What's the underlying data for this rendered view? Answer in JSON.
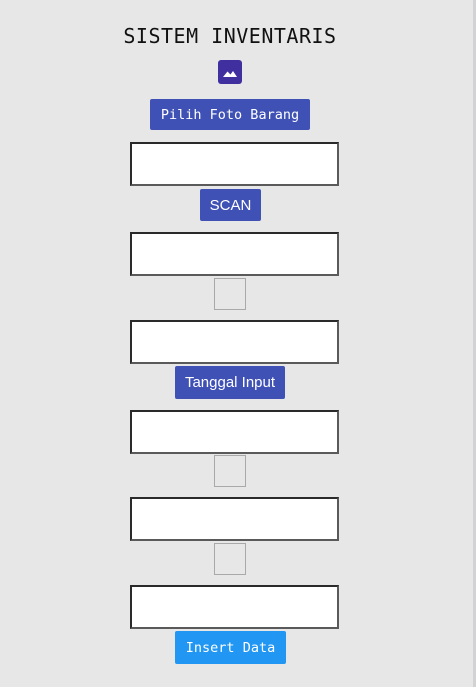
{
  "app": {
    "title": "SISTEM INVENTARIS"
  },
  "icons": {
    "image": "image-icon"
  },
  "buttons": {
    "pick_photo": "Pilih Foto Barang",
    "scan": "SCAN",
    "input_date": "Tanggal Input",
    "insert": "Insert Data"
  },
  "colors": {
    "background": "#e7e7e8",
    "primary_button": "#3f51b5",
    "insert_button": "#2196f3",
    "image_icon": "#3f2f9f"
  }
}
